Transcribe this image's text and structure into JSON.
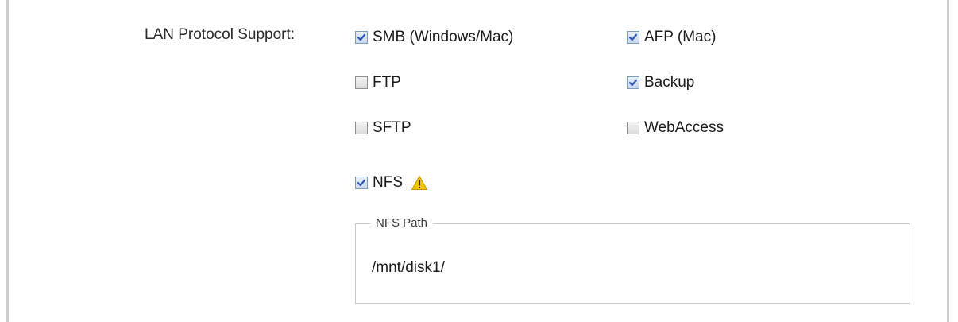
{
  "lan_protocol": {
    "label": "LAN Protocol Support:",
    "options": {
      "smb": {
        "label": "SMB (Windows/Mac)",
        "checked": true
      },
      "afp": {
        "label": "AFP (Mac)",
        "checked": true
      },
      "ftp": {
        "label": "FTP",
        "checked": false
      },
      "backup": {
        "label": "Backup",
        "checked": true
      },
      "sftp": {
        "label": "SFTP",
        "checked": false
      },
      "webaccess": {
        "label": "WebAccess",
        "checked": false
      },
      "nfs": {
        "label": "NFS",
        "checked": true,
        "icon": "warning-icon"
      }
    }
  },
  "nfs_path": {
    "legend": "NFS Path",
    "value": "/mnt/disk1/"
  },
  "colors": {
    "check_mark": "#2b56b5",
    "warning_fill": "#f5c400"
  }
}
